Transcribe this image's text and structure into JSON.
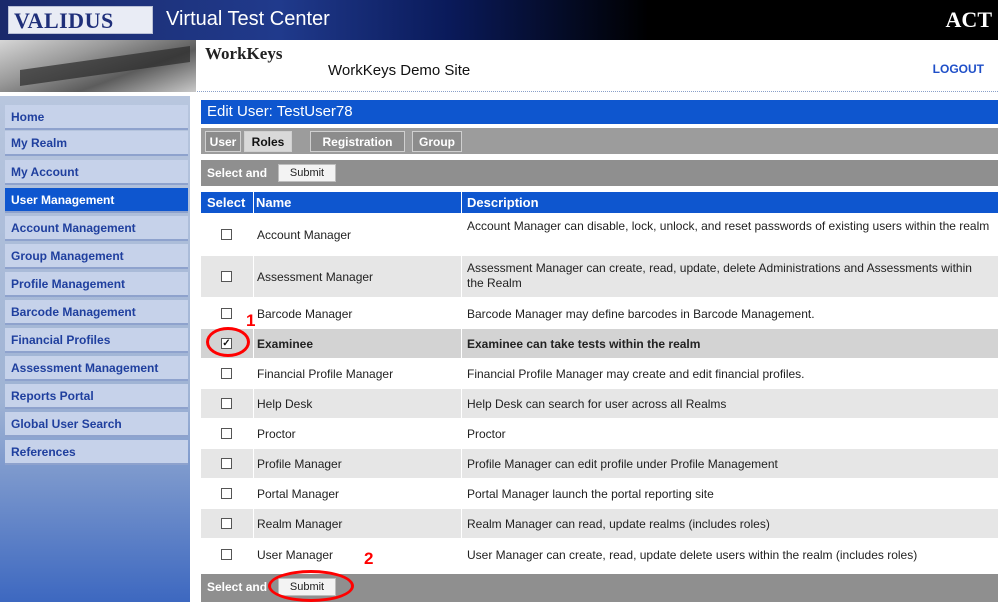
{
  "header": {
    "brand": "VALIDUS",
    "app_title": "Virtual Test Center",
    "org_logo": "ACT",
    "partner_logo": "WorkKeys",
    "site_name": "WorkKeys Demo Site",
    "logout_label": "LOGOUT"
  },
  "sidebar": {
    "items": [
      {
        "label": "Home"
      },
      {
        "label": "My Realm"
      },
      {
        "label": "My Account"
      },
      {
        "label": "User Management",
        "active": true
      },
      {
        "label": "Account Management"
      },
      {
        "label": "Group Management"
      },
      {
        "label": "Profile Management"
      },
      {
        "label": "Barcode Management"
      },
      {
        "label": "Financial Profiles"
      },
      {
        "label": "Assessment Management"
      },
      {
        "label": "Reports Portal"
      },
      {
        "label": "Global User Search"
      },
      {
        "label": "References"
      }
    ]
  },
  "main": {
    "title": "Edit User: TestUser78",
    "tabs": [
      {
        "label": "User"
      },
      {
        "label": "Roles",
        "active": true
      },
      {
        "label": "Registration"
      },
      {
        "label": "Group"
      }
    ],
    "toolbar_text_top": "Select and",
    "toolbar_text_bottom": "Select and",
    "submit_label": "Submit",
    "columns": [
      "Select",
      "Name",
      "Description"
    ],
    "rows": [
      {
        "name": "Account Manager",
        "description": "Account Manager can disable, lock, unlock, and reset passwords of existing users within the realm",
        "checked": false
      },
      {
        "name": "Assessment Manager",
        "description": "Assessment Manager can create, read, update, delete Administrations and Assessments within the Realm",
        "checked": false
      },
      {
        "name": "Barcode Manager",
        "description": "Barcode Manager may define barcodes in Barcode Management.",
        "checked": false
      },
      {
        "name": "Examinee",
        "description": "Examinee can take tests within the realm",
        "checked": true
      },
      {
        "name": "Financial Profile Manager",
        "description": "Financial Profile Manager may create and edit financial profiles.",
        "checked": false
      },
      {
        "name": "Help Desk",
        "description": "Help Desk can search for user across all Realms",
        "checked": false
      },
      {
        "name": "Proctor",
        "description": "Proctor",
        "checked": false
      },
      {
        "name": "Profile Manager",
        "description": "Profile Manager can edit profile under Profile Management",
        "checked": false
      },
      {
        "name": "Portal Manager",
        "description": "Portal Manager launch the portal reporting site",
        "checked": false
      },
      {
        "name": "Realm Manager",
        "description": "Realm Manager can read, update realms (includes roles)",
        "checked": false
      },
      {
        "name": "User Manager",
        "description": "User Manager can create, read, update delete users within the realm (includes roles)",
        "checked": false
      }
    ]
  },
  "annotations": {
    "step1": "1",
    "step2": "2",
    "color": "#ff0000"
  }
}
